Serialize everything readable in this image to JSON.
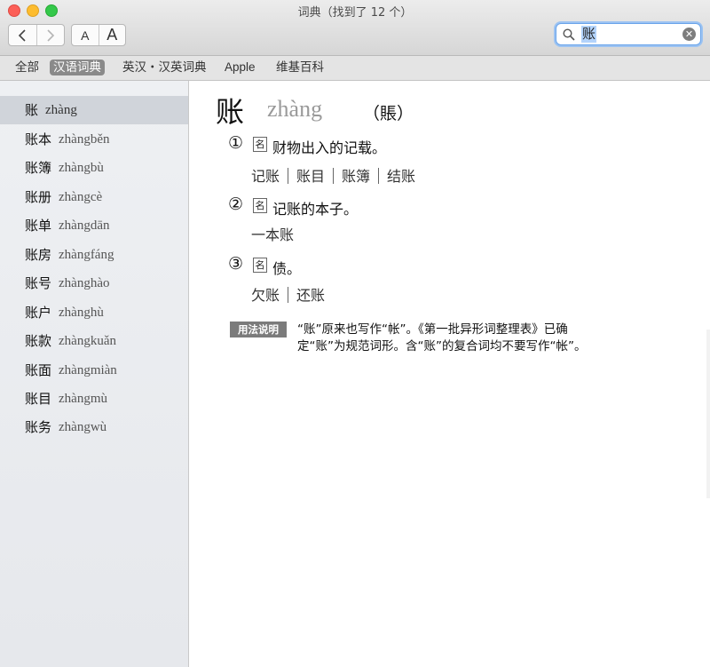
{
  "window": {
    "title": "词典（找到了 12 个）"
  },
  "toolbar": {
    "back_icon": "chevron-left-icon",
    "forward_icon": "chevron-right-icon",
    "font_smaller_label": "A",
    "font_larger_label": "A"
  },
  "search": {
    "value": "账",
    "icon": "magnifier-icon",
    "clear_icon": "clear-circle-icon"
  },
  "scopes": [
    {
      "label": "全部",
      "active": false
    },
    {
      "label": "汉语词典",
      "active": true
    },
    {
      "label": "英汉・汉英词典",
      "active": false
    },
    {
      "label": "Apple",
      "active": false
    },
    {
      "label": "维基百科",
      "active": false
    }
  ],
  "sidebar": {
    "items": [
      {
        "word": "账",
        "pinyin": "zhàng",
        "selected": true
      },
      {
        "word": "账本",
        "pinyin": "zhàngběn"
      },
      {
        "word": "账簿",
        "pinyin": "zhàngbù"
      },
      {
        "word": "账册",
        "pinyin": "zhàngcè"
      },
      {
        "word": "账单",
        "pinyin": "zhàngdān"
      },
      {
        "word": "账房",
        "pinyin": "zhàngfáng"
      },
      {
        "word": "账号",
        "pinyin": "zhànghào"
      },
      {
        "word": "账户",
        "pinyin": "zhànghù"
      },
      {
        "word": "账款",
        "pinyin": "zhàngkuǎn"
      },
      {
        "word": "账面",
        "pinyin": "zhàngmiàn"
      },
      {
        "word": "账目",
        "pinyin": "zhàngmù"
      },
      {
        "word": "账务",
        "pinyin": "zhàngwù"
      }
    ]
  },
  "entry": {
    "headword": "账",
    "pinyin": "zhàng",
    "variant": "（賬）",
    "senses": [
      {
        "num": "①",
        "pos": "名",
        "definition": "财物出入的记载。",
        "examples": [
          "记账",
          "账目",
          "账簿",
          "结账"
        ]
      },
      {
        "num": "②",
        "pos": "名",
        "definition": "记账的本子。",
        "examples": [
          "一本账"
        ]
      },
      {
        "num": "③",
        "pos": "名",
        "definition": "债。",
        "examples": [
          "欠账",
          "还账"
        ]
      }
    ],
    "usage": {
      "badge": "用法说明",
      "line1": "“账”原来也写作“帐”。《第一批异形词整理表》已确",
      "line2": "定“账”为规范词形。含“账”的复合词均不要写作“帐”。"
    }
  }
}
